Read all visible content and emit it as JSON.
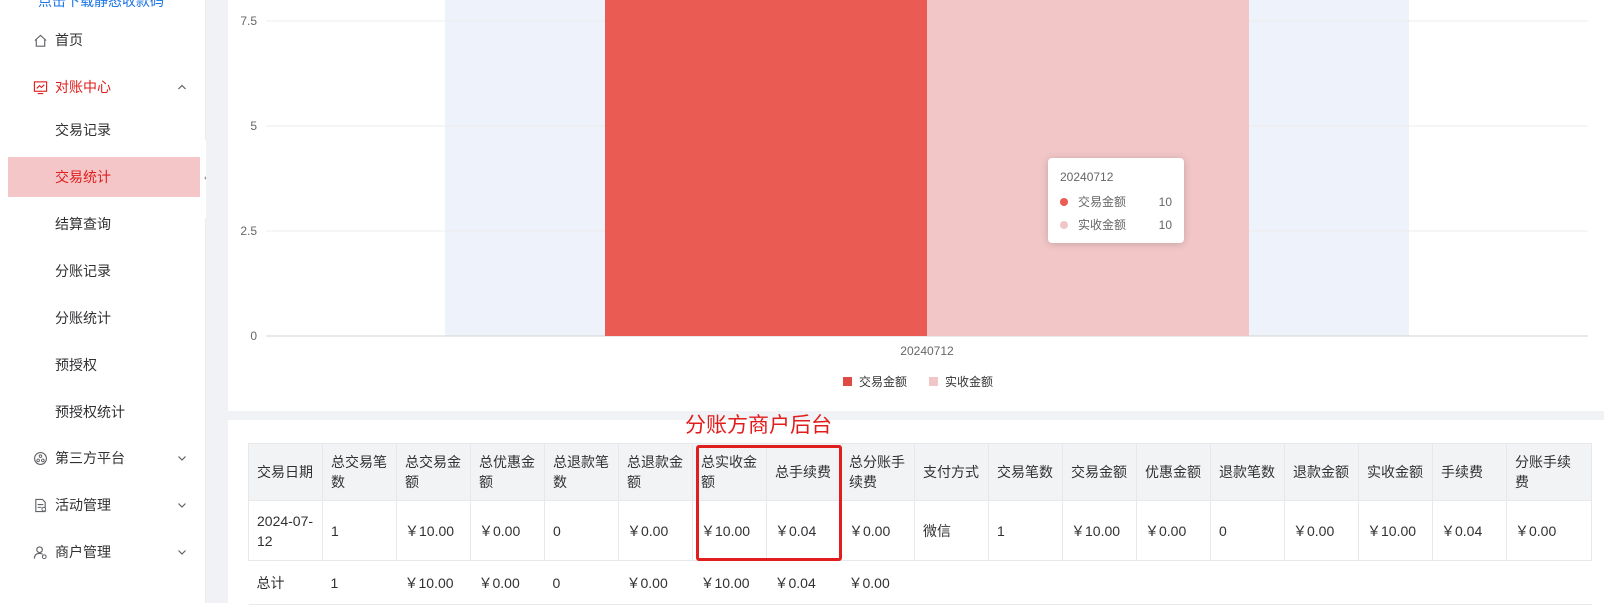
{
  "sidebar": {
    "top_link": "点击下载静态收款码",
    "home": "首页",
    "reconciliation": "对账中心",
    "sub_items": [
      "交易记录",
      "交易统计",
      "结算查询",
      "分账记录",
      "分账统计",
      "预授权",
      "预授权统计"
    ],
    "third_party": "第三方平台",
    "activity": "活动管理",
    "merchant": "商户管理"
  },
  "chart_data": {
    "type": "bar",
    "categories": [
      "20240712"
    ],
    "series": [
      {
        "name": "交易金额",
        "values": [
          10
        ],
        "color": "#ea5b54"
      },
      {
        "name": "实收金额",
        "values": [
          10
        ],
        "color": "#f2c6c7"
      }
    ],
    "ylim": [
      0,
      10
    ],
    "yticks": [
      "0",
      "2.5",
      "5",
      "7.5"
    ],
    "grid": true,
    "legend_position": "bottom-center"
  },
  "tooltip": {
    "title": "20240712",
    "rows": [
      {
        "name": "交易金额",
        "value": "10"
      },
      {
        "name": "实收金额",
        "value": "10"
      }
    ]
  },
  "annotation": "分账方商户后台",
  "table": {
    "headers": [
      "交易日期",
      "总交易笔数",
      "总交易金额",
      "总优惠金额",
      "总退款笔数",
      "总退款金额",
      "总实收金额",
      "总手续费",
      "总分账手续费",
      "支付方式",
      "交易笔数",
      "交易金额",
      "优惠金额",
      "退款笔数",
      "退款金额",
      "实收金额",
      "手续费",
      "分账手续费"
    ],
    "row": [
      "2024-07-12",
      "1",
      "￥10.00",
      "￥0.00",
      "0",
      "￥0.00",
      "￥10.00",
      "￥0.04",
      "￥0.00",
      "微信",
      "1",
      "￥10.00",
      "￥0.00",
      "0",
      "￥0.00",
      "￥10.00",
      "￥0.04",
      "￥0.00"
    ],
    "total": [
      "总计",
      "1",
      "￥10.00",
      "￥0.00",
      "0",
      "￥0.00",
      "￥10.00",
      "￥0.04",
      "￥0.00",
      "",
      "",
      "",
      "",
      "",
      "",
      "",
      "",
      ""
    ]
  },
  "colors": {
    "accent": "#e01e1e",
    "active_bg": "#f5c6c7",
    "link": "#1a73e8"
  }
}
